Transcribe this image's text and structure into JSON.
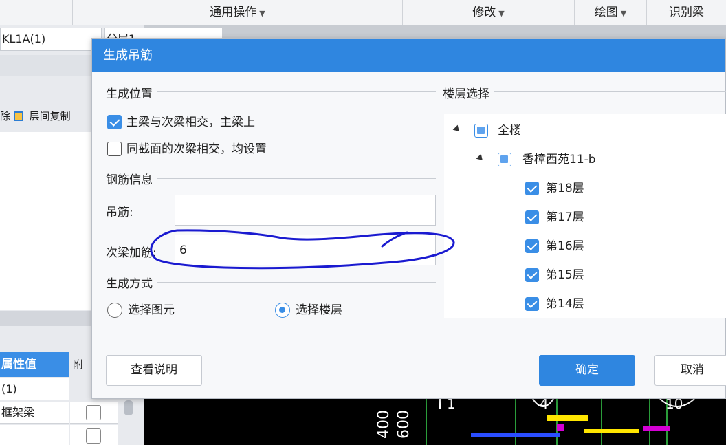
{
  "menubar": {
    "items": [
      {
        "label": "通用操作",
        "has_caret": true
      },
      {
        "label": "修改",
        "has_caret": true
      },
      {
        "label": "绘图",
        "has_caret": true
      },
      {
        "label": "识别梁",
        "has_caret": false
      }
    ]
  },
  "background": {
    "component_name": "KL1A(1)",
    "layer_name": "分层1",
    "tool_label": "层间复制",
    "tool_prefix": "除",
    "table": {
      "header_value": "属性值",
      "header_attach": "附",
      "rows": [
        "(1)",
        "框架梁"
      ]
    },
    "cad_texts": [
      "400",
      "600",
      "1",
      "4",
      "10"
    ]
  },
  "dialog": {
    "title": "生成吊筋",
    "position_group": {
      "heading": "生成位置",
      "options": [
        {
          "label": "主梁与次梁相交，主梁上",
          "checked": true
        },
        {
          "label": "同截面的次梁相交，均设置",
          "checked": false
        }
      ]
    },
    "rebar_group": {
      "heading": "钢筋信息",
      "hanger_label": "吊筋:",
      "hanger_value": "",
      "secondary_label": "次梁加筋:",
      "secondary_value": "6"
    },
    "method_group": {
      "heading": "生成方式",
      "options": [
        {
          "label": "选择图元",
          "selected": false
        },
        {
          "label": "选择楼层",
          "selected": true
        }
      ]
    },
    "floor_group": {
      "heading": "楼层选择",
      "tree": [
        {
          "label": "全楼",
          "level": 0,
          "state": "partial",
          "expanded": true
        },
        {
          "label": "香樟西苑11-b",
          "level": 1,
          "state": "partial",
          "expanded": true
        },
        {
          "label": "第18层",
          "level": 2,
          "state": "checked"
        },
        {
          "label": "第17层",
          "level": 2,
          "state": "checked"
        },
        {
          "label": "第16层",
          "level": 2,
          "state": "checked"
        },
        {
          "label": "第15层",
          "level": 2,
          "state": "checked"
        },
        {
          "label": "第14层",
          "level": 2,
          "state": "checked"
        }
      ]
    },
    "buttons": {
      "help": "查看说明",
      "ok": "确定",
      "cancel": "取消"
    }
  },
  "colors": {
    "accent": "#2f86e0",
    "annotation": "#1a1ad0"
  }
}
